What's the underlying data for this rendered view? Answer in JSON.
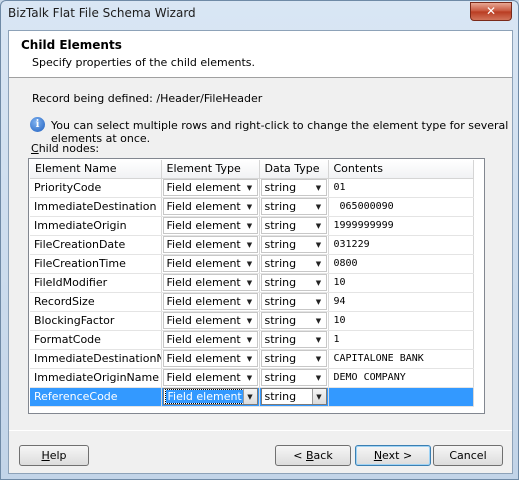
{
  "window": {
    "title": "BizTalk Flat File Schema Wizard",
    "close_glyph": "✕"
  },
  "header": {
    "title": "Child Elements",
    "subtitle": "Specify properties of the child elements."
  },
  "record_line": "Record being defined: /Header/FileHeader",
  "info": {
    "icon": "info-icon",
    "glyph": "i",
    "text": "You can select multiple rows and right-click to change the element type for several elements at once."
  },
  "child_nodes": {
    "accel": "C",
    "rest": "hild nodes:"
  },
  "table": {
    "columns": [
      "Element Name",
      "Element Type",
      "Data Type",
      "Contents"
    ],
    "rows": [
      {
        "name": "PriorityCode",
        "type": "Field element",
        "dtype": "string",
        "contents": "01"
      },
      {
        "name": "ImmediateDestination",
        "type": "Field element",
        "dtype": "string",
        "contents": " 065000090"
      },
      {
        "name": "ImmediateOrigin",
        "type": "Field element",
        "dtype": "string",
        "contents": "1999999999"
      },
      {
        "name": "FileCreationDate",
        "type": "Field element",
        "dtype": "string",
        "contents": "031229"
      },
      {
        "name": "FileCreationTime",
        "type": "Field element",
        "dtype": "string",
        "contents": "0800"
      },
      {
        "name": "FileIdModifier",
        "type": "Field element",
        "dtype": "string",
        "contents": "10"
      },
      {
        "name": "RecordSize",
        "type": "Field element",
        "dtype": "string",
        "contents": "94"
      },
      {
        "name": "BlockingFactor",
        "type": "Field element",
        "dtype": "string",
        "contents": "10"
      },
      {
        "name": "FormatCode",
        "type": "Field element",
        "dtype": "string",
        "contents": "1"
      },
      {
        "name": "ImmediateDestinationName",
        "type": "Field element",
        "dtype": "string",
        "contents": "CAPITALONE BANK"
      },
      {
        "name": "ImmediateOriginName",
        "type": "Field element",
        "dtype": "string",
        "contents": "DEMO COMPANY"
      },
      {
        "name": "ReferenceCode",
        "type": "Field element",
        "dtype": "string",
        "contents": "",
        "selected": true
      }
    ]
  },
  "buttons": {
    "help": {
      "accel": "H",
      "rest": "elp"
    },
    "back": {
      "pre": "< ",
      "accel": "B",
      "rest": "ack"
    },
    "next": {
      "accel": "N",
      "rest": "ext >"
    },
    "cancel": "Cancel"
  },
  "colors": {
    "selection": "#3399ff",
    "close": "#c6533a"
  }
}
